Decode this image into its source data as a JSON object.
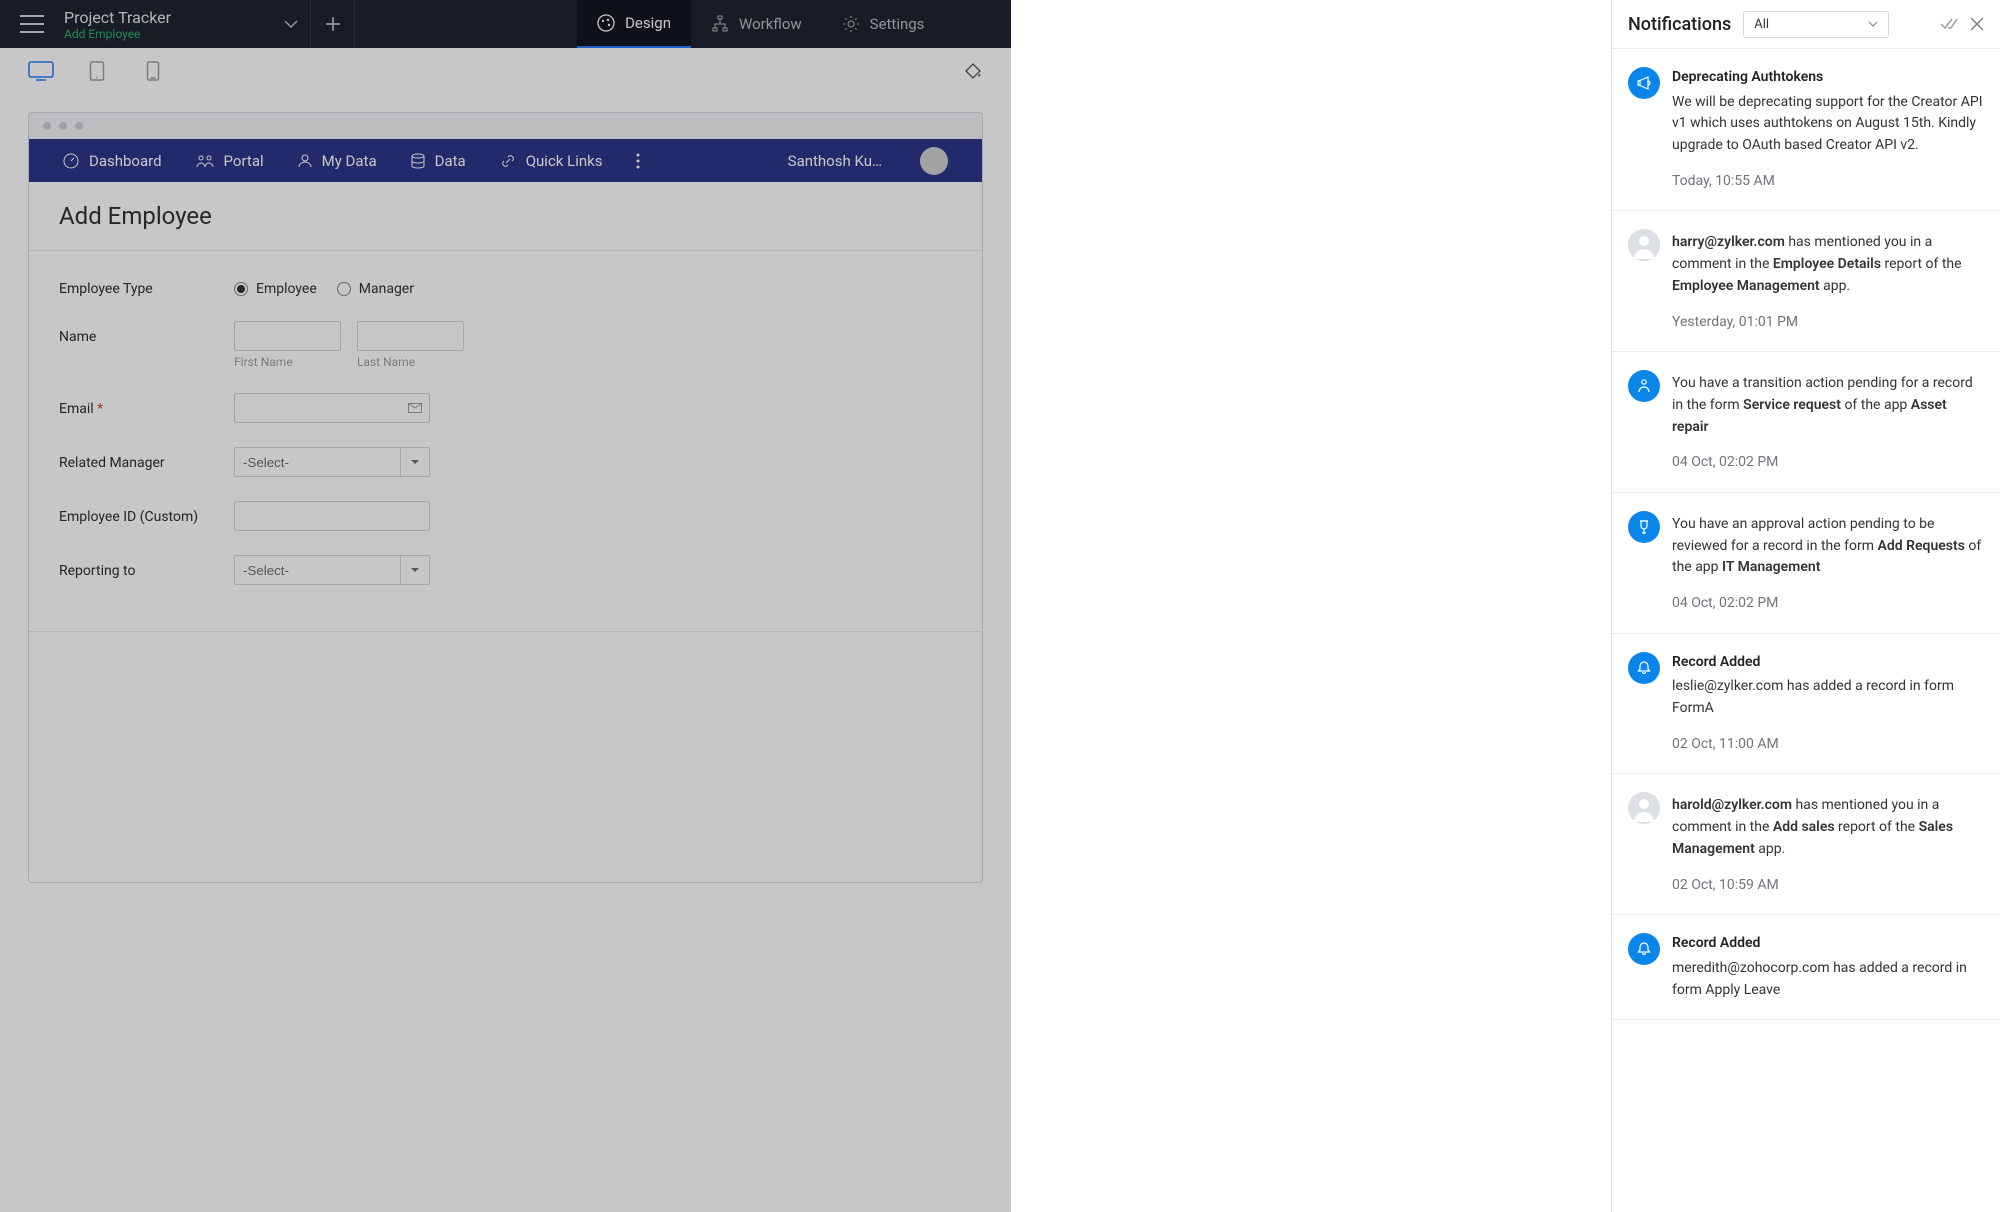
{
  "header": {
    "app_title": "Project Tracker",
    "crumb": "Add Employee",
    "tabs": [
      {
        "label": "Design"
      },
      {
        "label": "Workflow"
      },
      {
        "label": "Settings"
      }
    ]
  },
  "portal": {
    "nav": [
      {
        "label": "Dashboard"
      },
      {
        "label": "Portal"
      },
      {
        "label": "My Data"
      },
      {
        "label": "Data"
      },
      {
        "label": "Quick Links"
      }
    ],
    "user_name": "Santhosh Ku…"
  },
  "form": {
    "title": "Add Employee",
    "fields": {
      "employee_type": {
        "label": "Employee Type",
        "options": [
          "Employee",
          "Manager"
        ]
      },
      "name": {
        "label": "Name",
        "first_sub": "First Name",
        "last_sub": "Last Name"
      },
      "email": {
        "label": "Email"
      },
      "related_manager": {
        "label": "Related Manager",
        "placeholder": "-Select-"
      },
      "employee_id": {
        "label": "Employee ID (Custom)"
      },
      "reporting_to": {
        "label": "Reporting to",
        "placeholder": "-Select-"
      }
    }
  },
  "notifications": {
    "title": "Notifications",
    "filter": "All",
    "items": [
      {
        "icon": "megaphone",
        "heading": "Deprecating Authtokens",
        "body_plain": "We will be deprecating support for the Creator API v1 which uses authtokens on August 15th. Kindly upgrade to OAuth based Creator API v2.",
        "time": "Today, 10:55 AM"
      },
      {
        "icon": "avatar",
        "body_prefix_bold": "harry@zylker.com",
        "body_mid1": " has mentioned you in a comment in the ",
        "body_bold1": "Employee Details",
        "body_mid2": " report of the ",
        "body_bold2": "Employee Management",
        "body_suffix": " app.",
        "time": "Yesterday, 01:01 PM"
      },
      {
        "icon": "transition",
        "body_mid1": "You have a transition action pending for a record in the form ",
        "body_bold1": "Service request",
        "body_mid2": " of the app ",
        "body_bold2": "Asset repair",
        "time": "04 Oct, 02:02 PM"
      },
      {
        "icon": "approval",
        "body_mid1": "You have an approval action pending to be reviewed for a record in the form ",
        "body_bold1": "Add Requests",
        "body_mid2": " of the app ",
        "body_bold2": "IT Management",
        "time": "04 Oct, 02:02 PM"
      },
      {
        "icon": "bell",
        "heading": "Record Added",
        "body_plain": "leslie@zylker.com has added a record in form FormA",
        "time": "02 Oct, 11:00 AM"
      },
      {
        "icon": "avatar",
        "body_prefix_bold": "harold@zylker.com",
        "body_mid1": " has mentioned you in a comment in the ",
        "body_bold1": "Add sales",
        "body_mid2": " report of the ",
        "body_bold2": "Sales Management",
        "body_suffix": " app.",
        "time": "02 Oct, 10:59 AM"
      },
      {
        "icon": "bell",
        "heading": "Record Added",
        "body_plain": "meredith@zohocorp.com has added a record in form Apply Leave",
        "time": ""
      }
    ]
  }
}
